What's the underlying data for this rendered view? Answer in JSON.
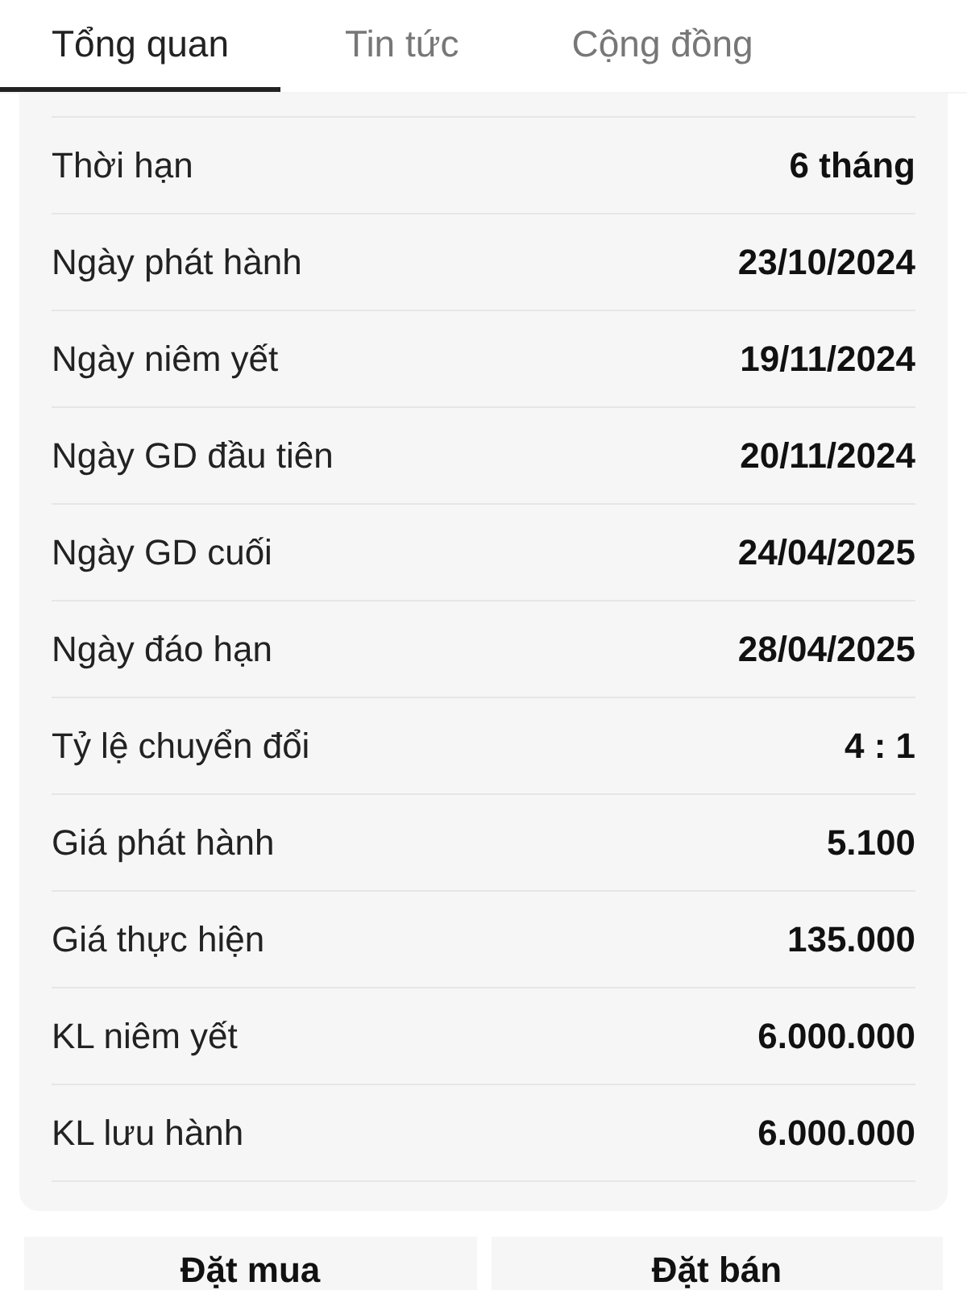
{
  "tabs": [
    {
      "label": "Tổng quan",
      "selected": true
    },
    {
      "label": "Tin tức",
      "selected": false
    },
    {
      "label": "Cộng đồng",
      "selected": false
    }
  ],
  "details": [
    {
      "label": "Thời hạn",
      "value": "6 tháng"
    },
    {
      "label": "Ngày phát hành",
      "value": "23/10/2024"
    },
    {
      "label": "Ngày niêm yết",
      "value": "19/11/2024"
    },
    {
      "label": "Ngày GD đầu tiên",
      "value": "20/11/2024"
    },
    {
      "label": "Ngày GD cuối",
      "value": "24/04/2025"
    },
    {
      "label": "Ngày đáo hạn",
      "value": "28/04/2025"
    },
    {
      "label": "Tỷ lệ chuyển đổi",
      "value": "4 : 1"
    },
    {
      "label": "Giá phát hành",
      "value": "5.100"
    },
    {
      "label": "Giá thực hiện",
      "value": "135.000"
    },
    {
      "label": "KL niêm yết",
      "value": "6.000.000"
    },
    {
      "label": "KL lưu hành",
      "value": "6.000.000"
    }
  ],
  "buttons": [
    "Đặt mua",
    "Đặt bán"
  ]
}
